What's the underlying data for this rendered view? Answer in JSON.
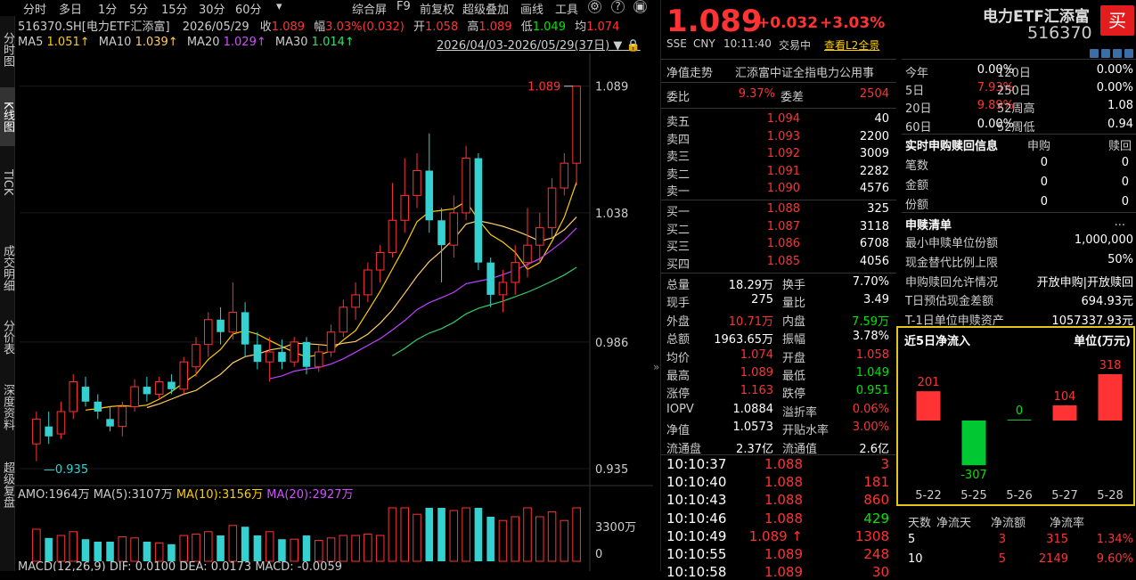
{
  "toolbar": {
    "items": [
      "分时",
      "多日",
      "1分",
      "5分",
      "15分",
      "30分",
      "60分",
      "▾",
      "综合屏",
      "F9",
      "前复权",
      "超级叠加",
      "画线",
      "工具"
    ],
    "icons": [
      "gear-icon",
      "help-icon",
      "window-icon"
    ]
  },
  "vtabs": [
    "分时图",
    "K线图",
    "TICK",
    "成交明细",
    "分价表",
    "深度资料",
    "超级复盘"
  ],
  "info": {
    "code": "516370.SH[电力ETF汇添富]",
    "date": "2026/05/29",
    "close_label": "收",
    "close": "1.089",
    "amp_label": "幅",
    "amp": "3.03%(0.032)",
    "open_label": "开",
    "open": "1.058",
    "high_label": "高",
    "high": "1.089",
    "low_label": "低",
    "low": "1.049",
    "avg_label": "均",
    "avg": "1.074"
  },
  "ma": {
    "ma5": "MA5",
    "ma5v": "1.051↑",
    "ma10": "MA10",
    "ma10v": "1.039↑",
    "ma20": "MA20",
    "ma20v": "1.029↑",
    "ma30": "MA30",
    "ma30v": "1.014↑",
    "range": "2026/04/03-2026/05/29(37日)"
  },
  "price_axis": [
    "1.089",
    "1.038",
    "0.986",
    "0.935"
  ],
  "kline": {
    "high_label": "1.089",
    "low_label": "0.935",
    "ylim": [
      0.93,
      1.095
    ],
    "bars": [
      {
        "o": 0.945,
        "c": 0.955,
        "h": 0.958,
        "l": 0.938
      },
      {
        "o": 0.952,
        "c": 0.948,
        "h": 0.958,
        "l": 0.945
      },
      {
        "o": 0.949,
        "c": 0.958,
        "h": 0.962,
        "l": 0.947
      },
      {
        "o": 0.958,
        "c": 0.97,
        "h": 0.973,
        "l": 0.955
      },
      {
        "o": 0.968,
        "c": 0.962,
        "h": 0.972,
        "l": 0.96
      },
      {
        "o": 0.962,
        "c": 0.958,
        "h": 0.965,
        "l": 0.955
      },
      {
        "o": 0.955,
        "c": 0.952,
        "h": 0.96,
        "l": 0.95
      },
      {
        "o": 0.952,
        "c": 0.96,
        "h": 0.962,
        "l": 0.948
      },
      {
        "o": 0.96,
        "c": 0.968,
        "h": 0.971,
        "l": 0.958
      },
      {
        "o": 0.968,
        "c": 0.965,
        "h": 0.972,
        "l": 0.962
      },
      {
        "o": 0.965,
        "c": 0.97,
        "h": 0.972,
        "l": 0.963
      },
      {
        "o": 0.97,
        "c": 0.967,
        "h": 0.973,
        "l": 0.965
      },
      {
        "o": 0.967,
        "c": 0.978,
        "h": 0.98,
        "l": 0.965
      },
      {
        "o": 0.976,
        "c": 0.985,
        "h": 0.988,
        "l": 0.972
      },
      {
        "o": 0.985,
        "c": 0.995,
        "h": 0.998,
        "l": 0.98
      },
      {
        "o": 0.995,
        "c": 0.99,
        "h": 1.0,
        "l": 0.985
      },
      {
        "o": 0.99,
        "c": 0.998,
        "h": 1.01,
        "l": 0.987
      },
      {
        "o": 0.998,
        "c": 0.985,
        "h": 1.002,
        "l": 0.98
      },
      {
        "o": 0.985,
        "c": 0.978,
        "h": 0.99,
        "l": 0.975
      },
      {
        "o": 0.978,
        "c": 0.982,
        "h": 0.988,
        "l": 0.97
      },
      {
        "o": 0.982,
        "c": 0.978,
        "h": 0.987,
        "l": 0.975
      },
      {
        "o": 0.978,
        "c": 0.986,
        "h": 0.988,
        "l": 0.976
      },
      {
        "o": 0.986,
        "c": 0.976,
        "h": 0.988,
        "l": 0.973
      },
      {
        "o": 0.976,
        "c": 0.982,
        "h": 0.985,
        "l": 0.974
      },
      {
        "o": 0.982,
        "c": 0.99,
        "h": 0.993,
        "l": 0.98
      },
      {
        "o": 0.99,
        "c": 1.0,
        "h": 1.003,
        "l": 0.988
      },
      {
        "o": 1.0,
        "c": 1.005,
        "h": 1.01,
        "l": 0.995
      },
      {
        "o": 1.005,
        "c": 1.015,
        "h": 1.018,
        "l": 1.002
      },
      {
        "o": 1.015,
        "c": 1.022,
        "h": 1.025,
        "l": 1.01
      },
      {
        "o": 1.022,
        "c": 1.035,
        "h": 1.05,
        "l": 1.02
      },
      {
        "o": 1.035,
        "c": 1.045,
        "h": 1.06,
        "l": 1.03
      },
      {
        "o": 1.045,
        "c": 1.055,
        "h": 1.062,
        "l": 1.04
      },
      {
        "o": 1.055,
        "c": 1.035,
        "h": 1.07,
        "l": 1.03
      },
      {
        "o": 1.035,
        "c": 1.025,
        "h": 1.04,
        "l": 1.01
      },
      {
        "o": 1.025,
        "c": 1.038,
        "h": 1.045,
        "l": 1.02
      },
      {
        "o": 1.038,
        "c": 1.06,
        "h": 1.065,
        "l": 1.035
      },
      {
        "o": 1.06,
        "c": 1.018,
        "h": 1.062,
        "l": 1.015
      },
      {
        "o": 1.018,
        "c": 1.005,
        "h": 1.02,
        "l": 1.0
      },
      {
        "o": 1.005,
        "c": 1.01,
        "h": 1.015,
        "l": 0.998
      },
      {
        "o": 1.01,
        "c": 1.018,
        "h": 1.025,
        "l": 1.005
      },
      {
        "o": 1.018,
        "c": 1.025,
        "h": 1.04,
        "l": 1.012
      },
      {
        "o": 1.025,
        "c": 1.032,
        "h": 1.038,
        "l": 1.018
      },
      {
        "o": 1.032,
        "c": 1.048,
        "h": 1.052,
        "l": 1.028
      },
      {
        "o": 1.048,
        "c": 1.058,
        "h": 1.062,
        "l": 1.045
      },
      {
        "o": 1.058,
        "c": 1.089,
        "h": 1.089,
        "l": 1.049
      }
    ]
  },
  "amo": {
    "label": "AMO:",
    "value": "1964万",
    "ma5": "MA(5):",
    "ma5v": "3107万",
    "ma10": "MA(10):",
    "ma10v": "3156万",
    "ma20": "MA(20):",
    "ma20v": "2927万",
    "axis": "3300万",
    "axis0": "0"
  },
  "macd": {
    "text": "MACD(12,26,9) DIF: 0.0100 DEA: 0.0173 MACD: -0.0059"
  },
  "quote": {
    "price": "1.089",
    "chg": "+0.032",
    "pct": "+3.03%",
    "name": "电力ETF汇添富",
    "code": "516370",
    "buy": "买",
    "market": "SSE",
    "ccy": "CNY",
    "time": "10:11:40",
    "status": "交易中",
    "l2": "查看L2全景"
  },
  "trend": {
    "label": "净值走势",
    "desc": "汇添富中证全指电力公用事"
  },
  "weibi": {
    "l1": "委比",
    "v1": "9.37%",
    "l2": "委差",
    "v2": "2504"
  },
  "asks": [
    {
      "n": "卖五",
      "p": "1.094",
      "v": "40"
    },
    {
      "n": "卖四",
      "p": "1.093",
      "v": "2200"
    },
    {
      "n": "卖三",
      "p": "1.092",
      "v": "3009"
    },
    {
      "n": "卖二",
      "p": "1.091",
      "v": "2282"
    },
    {
      "n": "卖一",
      "p": "1.090",
      "v": "4576"
    }
  ],
  "bids": [
    {
      "n": "买一",
      "p": "1.088",
      "v": "325"
    },
    {
      "n": "买二",
      "p": "1.087",
      "v": "3118"
    },
    {
      "n": "买三",
      "p": "1.086",
      "v": "6708"
    },
    {
      "n": "买四",
      "p": "1.085",
      "v": "4056"
    }
  ],
  "stats": [
    {
      "l1": "总量",
      "v1": "18.29万",
      "c1": "white",
      "l2": "换手",
      "v2": "7.70%",
      "c2": "white"
    },
    {
      "l1": "现手",
      "v1": "275",
      "c1": "white",
      "l2": "量比",
      "v2": "3.49",
      "c2": "white"
    },
    {
      "l1": "外盘",
      "v1": "10.71万",
      "c1": "red",
      "l2": "内盘",
      "v2": "7.59万",
      "c2": "green"
    },
    {
      "l1": "总额",
      "v1": "1963.65万",
      "c1": "white",
      "l2": "振幅",
      "v2": "3.78%",
      "c2": "white"
    },
    {
      "l1": "均价",
      "v1": "1.074",
      "c1": "red",
      "l2": "开盘",
      "v2": "1.058",
      "c2": "red"
    },
    {
      "l1": "最高",
      "v1": "1.089",
      "c1": "red",
      "l2": "最低",
      "v2": "1.049",
      "c2": "green"
    },
    {
      "l1": "涨停",
      "v1": "1.163",
      "c1": "red",
      "l2": "跌停",
      "v2": "0.951",
      "c2": "green"
    },
    {
      "l1": "IOPV",
      "v1": "1.0884",
      "c1": "white",
      "l2": "溢折率",
      "v2": "0.06%",
      "c2": "red"
    },
    {
      "l1": "净值",
      "v1": "1.0573",
      "c1": "white",
      "l2": "开贴水率",
      "v2": "3.00%",
      "c2": "red"
    },
    {
      "l1": "流通盘",
      "v1": "2.37亿",
      "c1": "white",
      "l2": "流通值",
      "v2": "2.6亿",
      "c2": "white"
    }
  ],
  "ticks": [
    {
      "t": "10:10:37",
      "p": "1.088",
      "v": "3",
      "c": "red"
    },
    {
      "t": "10:10:40",
      "p": "1.088",
      "v": "181",
      "c": "red"
    },
    {
      "t": "10:10:43",
      "p": "1.088",
      "v": "860",
      "c": "red"
    },
    {
      "t": "10:10:46",
      "p": "1.088",
      "v": "429",
      "c": "green"
    },
    {
      "t": "10:10:49",
      "p": "1.089 ↑",
      "v": "1308",
      "c": "red"
    },
    {
      "t": "10:10:55",
      "p": "1.089",
      "v": "248",
      "c": "red"
    },
    {
      "t": "10:10:58",
      "p": "1.089",
      "v": "30",
      "c": "red"
    }
  ],
  "perf": [
    {
      "l1": "今年",
      "v1": "0.00%",
      "c1": "white",
      "l2": "120日",
      "v2": "0.00%",
      "c2": "white"
    },
    {
      "l1": "5日",
      "v1": "7.93%",
      "c1": "red",
      "l2": "250日",
      "v2": "0.00%",
      "c2": "white"
    },
    {
      "l1": "20日",
      "v1": "9.89%",
      "c1": "red",
      "l2": "52周高",
      "v2": "1.08",
      "c2": "white"
    },
    {
      "l1": "60日",
      "v1": "0.00%",
      "c1": "white",
      "l2": "52周低",
      "v2": "0.94",
      "c2": "white"
    }
  ],
  "realtime": {
    "title": "实时申购赎回信息",
    "h1": "申购",
    "h2": "赎回",
    "rows": [
      {
        "l": "笔数",
        "a": "0",
        "b": "0"
      },
      {
        "l": "金额",
        "a": "0",
        "b": "0"
      },
      {
        "l": "份额",
        "a": "0",
        "b": "0"
      }
    ]
  },
  "list": {
    "title": "申赎清单",
    "more": "...",
    "rows": [
      {
        "l": "最小申赎单位份额",
        "v": "1,000,000"
      },
      {
        "l": "现金替代比例上限",
        "v": "50%"
      },
      {
        "l": "申购赎回允许情况",
        "v": "开放申购|开放赎回"
      },
      {
        "l": "T日预估现金差额",
        "v": "694.93元"
      },
      {
        "l": "T-1日单位申赎资产",
        "v": "1057337.93元"
      }
    ]
  },
  "flow": {
    "title": "近5日净流入",
    "unit": "单位(万元)"
  },
  "chart_data": {
    "type": "bar",
    "categories": [
      "5-22",
      "5-25",
      "5-26",
      "5-27",
      "5-28"
    ],
    "values": [
      201,
      -307,
      0,
      104,
      318
    ]
  },
  "flow_table": {
    "headers": [
      "天数",
      "净流天",
      "净流额",
      "净流率"
    ],
    "rows": [
      [
        "5",
        "3",
        "315",
        "1.34%"
      ],
      [
        "10",
        "5",
        "2149",
        "9.60%"
      ]
    ]
  }
}
